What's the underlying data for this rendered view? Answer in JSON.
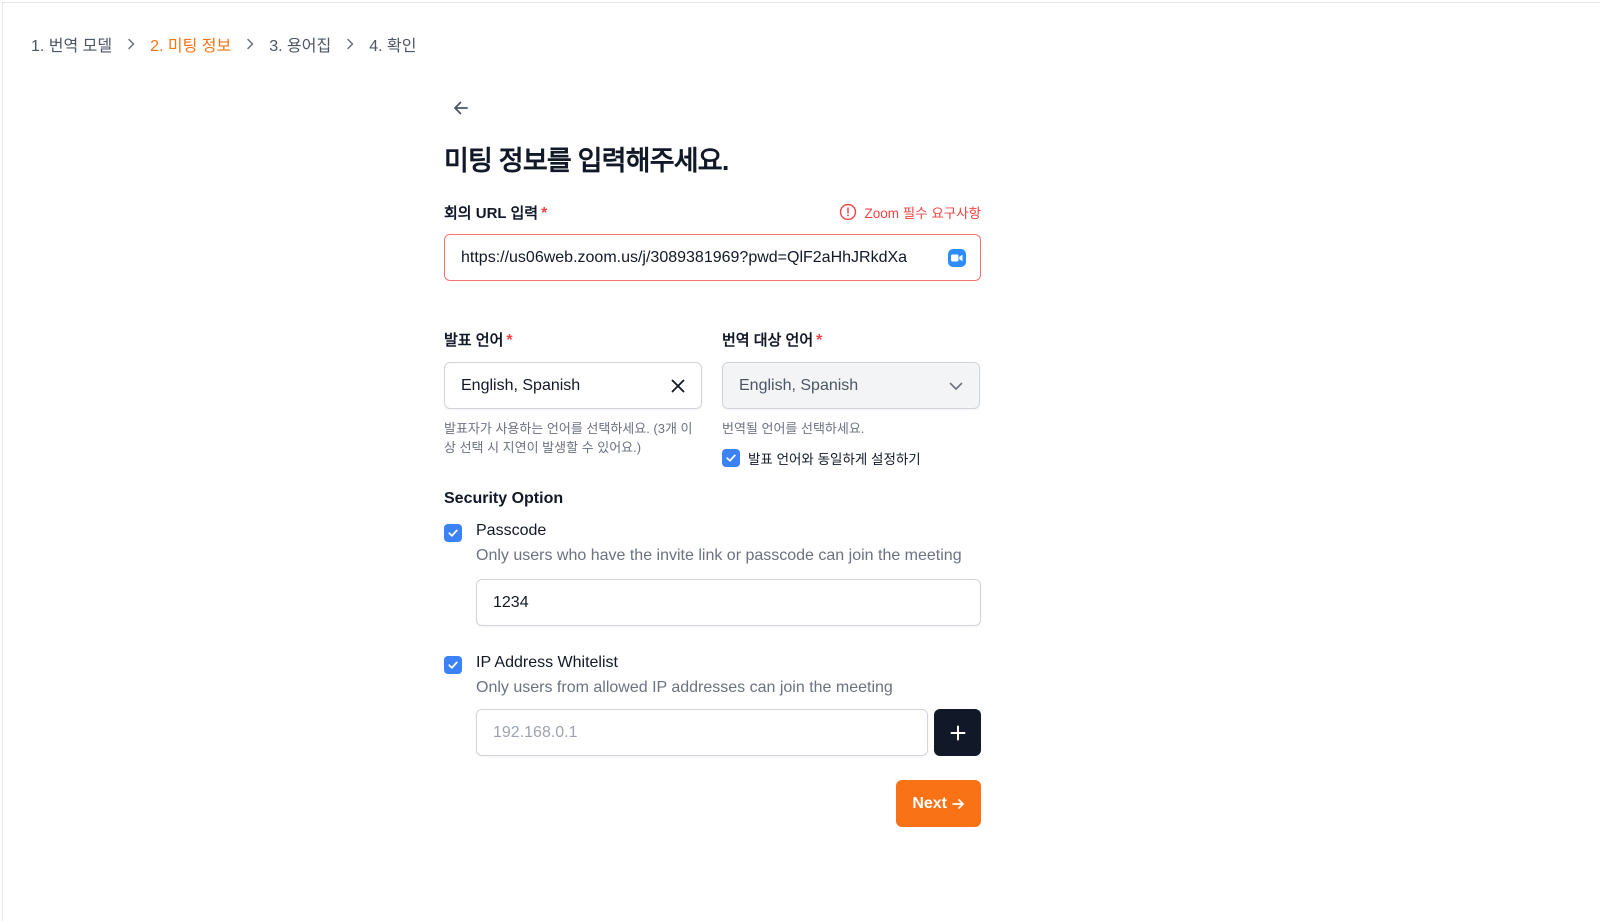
{
  "breadcrumb": {
    "steps": [
      {
        "label": "1. 번역 모델"
      },
      {
        "label": "2. 미팅 정보"
      },
      {
        "label": "3. 용어집"
      },
      {
        "label": "4. 확인"
      }
    ],
    "active_index": 1
  },
  "page": {
    "title": "미팅 정보를 입력해주세요."
  },
  "meeting_url": {
    "label": "회의 URL 입력",
    "required_mark": "*",
    "warning": "Zoom 필수 요구사항",
    "value": "https://us06web.zoom.us/j/3089381969?pwd=QlF2aHhJRkdXa",
    "icon": "zoom-logo-icon"
  },
  "source_language": {
    "label": "발표 언어",
    "required_mark": "*",
    "value": "English, Spanish",
    "hint": "발표자가 사용하는 언어를 선택하세요. (3개 이상 선택 시 지연이 발생할 수 있어요.)"
  },
  "target_language": {
    "label": "번역 대상 언어",
    "required_mark": "*",
    "value": "English, Spanish",
    "hint": "번역될 언어를 선택하세요.",
    "same_as_source_label": "발표 언어와 동일하게 설정하기",
    "same_as_source_checked": true
  },
  "security": {
    "title": "Security Option",
    "passcode": {
      "label": "Passcode",
      "checked": true,
      "description": "Only users who have the invite link or passcode can join the meeting",
      "value": "1234"
    },
    "ip_whitelist": {
      "label": "IP Address Whitelist",
      "checked": true,
      "description": "Only users from allowed IP addresses can join the meeting",
      "placeholder": "192.168.0.1"
    }
  },
  "actions": {
    "next_label": "Next"
  },
  "colors": {
    "accent": "#f97316",
    "checkbox": "#3b82f6",
    "error": "#ef4444",
    "dark_button": "#111827"
  }
}
